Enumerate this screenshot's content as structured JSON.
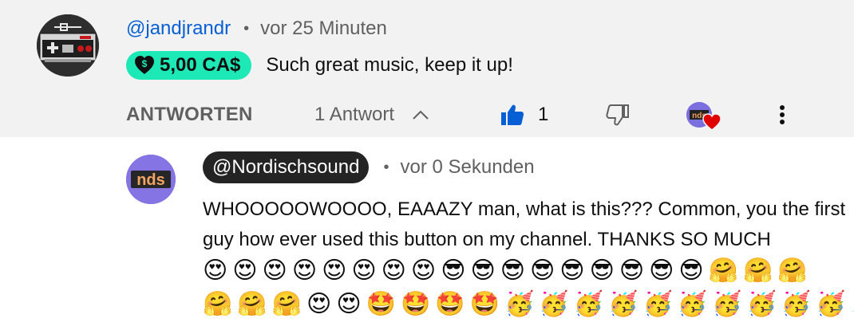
{
  "comment": {
    "author": "@jandjrandr",
    "separator": "•",
    "time": "vor 25 Minuten",
    "super_thanks": {
      "amount": "5,00 CA$",
      "chip_color": "#1de9b6"
    },
    "text": "Such great music, keep it up!",
    "actions": {
      "reply_label": "ANTWORTEN",
      "replies_label": "1 Antwort",
      "like_count": "1",
      "accent_color": "#065fd4"
    }
  },
  "reply": {
    "author": "@Nordischsound",
    "separator": "•",
    "time": "vor 0 Sekunden",
    "text": "WHOOOOOWOOOO, EAAAZY man, what is this??? Common, you the first guy how ever used this button on my channel. THANKS SO MUCH",
    "emoji_line_1": "😍😍😍😍😍😍😍😍😎😎😎😎😎😎😎😎😎🤗🤗🤗",
    "emoji_line_2": "🤗🤗🤗😍😍🤩🤩🤩🤩🥳🥳🥳🥳🥳🥳🥳🥳🥳🥳🥳"
  },
  "icons": {
    "avatar_main": "nes-controller-avatar",
    "avatar_reply": "nds-logo-avatar",
    "like": "thumbs-up-icon",
    "dislike": "thumbs-down-icon",
    "creator_heart": "creator-heart-icon",
    "more": "more-vert-icon",
    "replies_toggle": "chevron-up-icon"
  }
}
